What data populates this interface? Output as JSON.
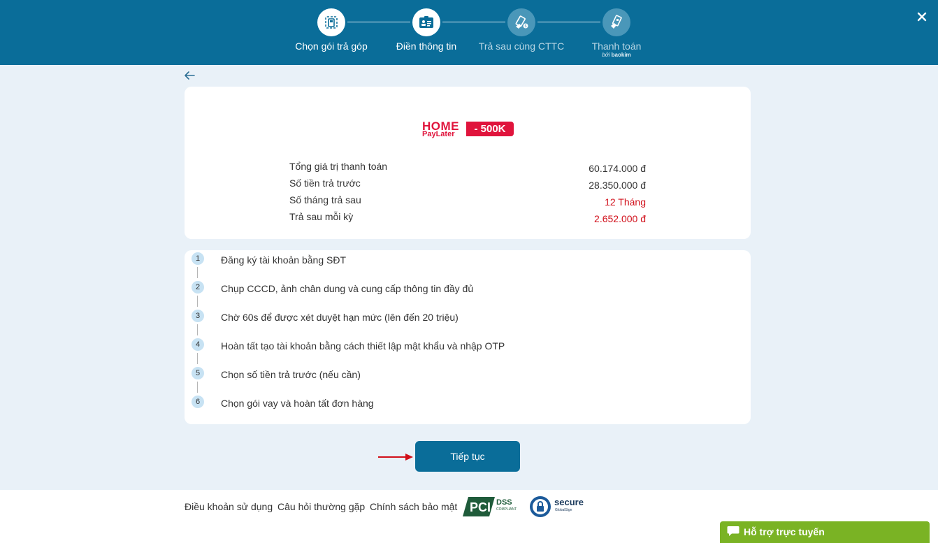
{
  "header": {
    "steps": [
      {
        "label": "Chọn gói trả góp",
        "state": "active",
        "icon": "phone-card-icon"
      },
      {
        "label": "Điền thông tin",
        "state": "active",
        "icon": "id-card-icon"
      },
      {
        "label": "Trả sau cùng CTTC",
        "state": "inactive",
        "icon": "money-hand-icon"
      },
      {
        "label": "Thanh toán",
        "state": "inactive",
        "icon": "card-hand-icon",
        "sub_prefix": "bởi",
        "sub_brand": "baokim"
      }
    ],
    "close_icon": "close-icon"
  },
  "back_icon": "arrow-left-icon",
  "summary": {
    "logo_home": "HOME",
    "logo_paylater": "PayLater",
    "logo_badge": "- 500K",
    "rows": [
      {
        "label": "Tổng giá trị thanh toán",
        "value": "60.174.000 đ",
        "highlight": false
      },
      {
        "label": "Số tiền trả trước",
        "value": "28.350.000 đ",
        "highlight": false
      },
      {
        "label": "Số tháng trả sau",
        "value": "12 Tháng",
        "highlight": true
      },
      {
        "label": "Trả sau mỗi kỳ",
        "value": "2.652.000 đ",
        "highlight": true
      }
    ]
  },
  "process_steps": [
    {
      "num": "1",
      "text": "Đăng ký tài khoản bằng SĐT"
    },
    {
      "num": "2",
      "text": "Chụp CCCD, ảnh chân dung và cung cấp thông tin đầy đủ"
    },
    {
      "num": "3",
      "text": "Chờ 60s để được xét duyệt hạn mức (lên đến 20 triệu)"
    },
    {
      "num": "4",
      "text": "Hoàn tất tạo tài khoản bằng cách thiết lập mật khẩu và nhập OTP"
    },
    {
      "num": "5",
      "text": "Chọn số tiền trả trước (nếu cần)"
    },
    {
      "num": "6",
      "text": "Chọn gói vay và hoàn tất đơn hàng"
    }
  ],
  "continue_button": "Tiếp tục",
  "footer": {
    "links": [
      "Điều khoản sử dụng",
      "Câu hỏi thường gặp",
      "Chính sách bảo mật"
    ],
    "pci_text": "PCI",
    "dss_text": "DSS",
    "compliant_text": "COMPLIANT",
    "secure_text": "secure",
    "globalsign_text": "GlobalSign"
  },
  "support": {
    "label": "Hỗ trợ trực tuyến",
    "icon": "chat-bubble-icon"
  },
  "colors": {
    "primary": "#0a6d99",
    "accent_red": "#e0143c",
    "value_red": "#d10f1a",
    "support_green": "#7ab324",
    "page_bg": "#e9f1f8"
  }
}
